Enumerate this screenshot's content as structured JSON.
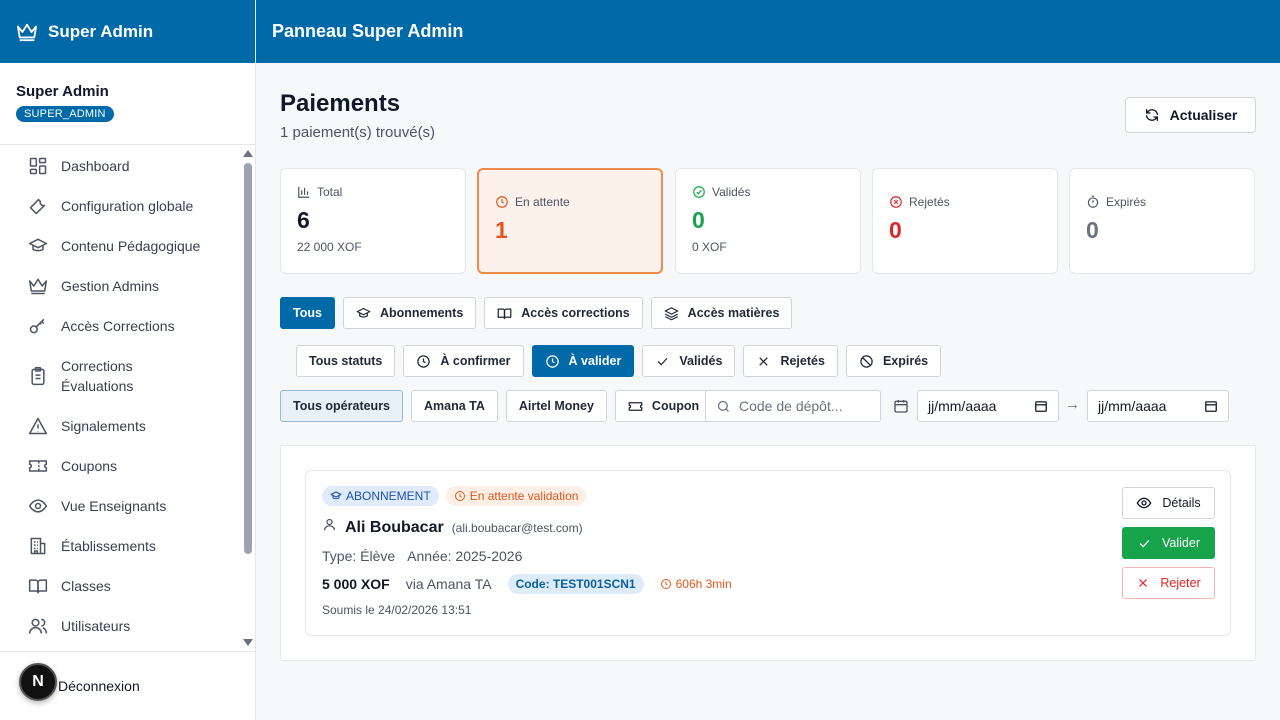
{
  "sidebar": {
    "brand": "Super Admin",
    "user_name": "Super Admin",
    "role": "SUPER_ADMIN",
    "items": [
      {
        "label": "Dashboard",
        "icon": "dashboard-icon"
      },
      {
        "label": "Configuration globale",
        "icon": "wrench-icon"
      },
      {
        "label": "Contenu Pédagogique",
        "icon": "graduation-cap-icon"
      },
      {
        "label": "Gestion Admins",
        "icon": "crown-icon"
      },
      {
        "label": "Accès Corrections",
        "icon": "key-icon"
      },
      {
        "label": "Corrections Évaluations",
        "icon": "clipboard-icon"
      },
      {
        "label": "Signalements",
        "icon": "warning-icon"
      },
      {
        "label": "Coupons",
        "icon": "ticket-icon"
      },
      {
        "label": "Vue Enseignants",
        "icon": "eye-icon"
      },
      {
        "label": "Établissements",
        "icon": "building-icon"
      },
      {
        "label": "Classes",
        "icon": "book-icon"
      },
      {
        "label": "Utilisateurs",
        "icon": "users-icon"
      }
    ],
    "logout": "Déconnexion",
    "dev_badge": "N"
  },
  "topbar": {
    "title": "Panneau Super Admin"
  },
  "page": {
    "title": "Paiements",
    "subtitle": "1 paiement(s) trouvé(s)",
    "refresh_label": "Actualiser"
  },
  "stats": [
    {
      "label": "Total",
      "value": "6",
      "amount": "22 000 XOF",
      "color": "#111827"
    },
    {
      "label": "En attente",
      "value": "1",
      "amount": "",
      "color": "#e0561b"
    },
    {
      "label": "Validés",
      "value": "0",
      "amount": "0 XOF",
      "color": "#16a34a"
    },
    {
      "label": "Rejetés",
      "value": "0",
      "amount": "",
      "color": "#dc2626"
    },
    {
      "label": "Expirés",
      "value": "0",
      "amount": "",
      "color": "#6b7280"
    }
  ],
  "type_filters": [
    "Tous",
    "Abonnements",
    "Accès corrections",
    "Accès matières"
  ],
  "status_filters": [
    "Tous statuts",
    "À confirmer",
    "À valider",
    "Validés",
    "Rejetés",
    "Expirés"
  ],
  "operator_filters": [
    "Tous opérateurs",
    "Amana TA",
    "Airtel Money",
    "Coupon"
  ],
  "search": {
    "placeholder": "Code de dépôt..."
  },
  "date_from": "jj/mm/aaaa",
  "date_to": "jj/mm/aaaa",
  "payment": {
    "type_badge": "ABONNEMENT",
    "status_badge": "En attente validation",
    "name": "Ali Boubacar",
    "email": "(ali.boubacar@test.com)",
    "type": "Type: Élève",
    "year": "Année: 2025-2026",
    "amount": "5 000 XOF",
    "via": "via Amana TA",
    "code": "Code: TEST001SCN1",
    "timer": "606h 3min",
    "submitted": "Soumis le 24/02/2026 13:51",
    "details_label": "Détails",
    "validate_label": "Valider",
    "reject_label": "Rejeter"
  },
  "colors": {
    "primary": "#0069a8",
    "success": "#16a34a",
    "danger": "#dc2626",
    "warning": "#e0561b"
  }
}
